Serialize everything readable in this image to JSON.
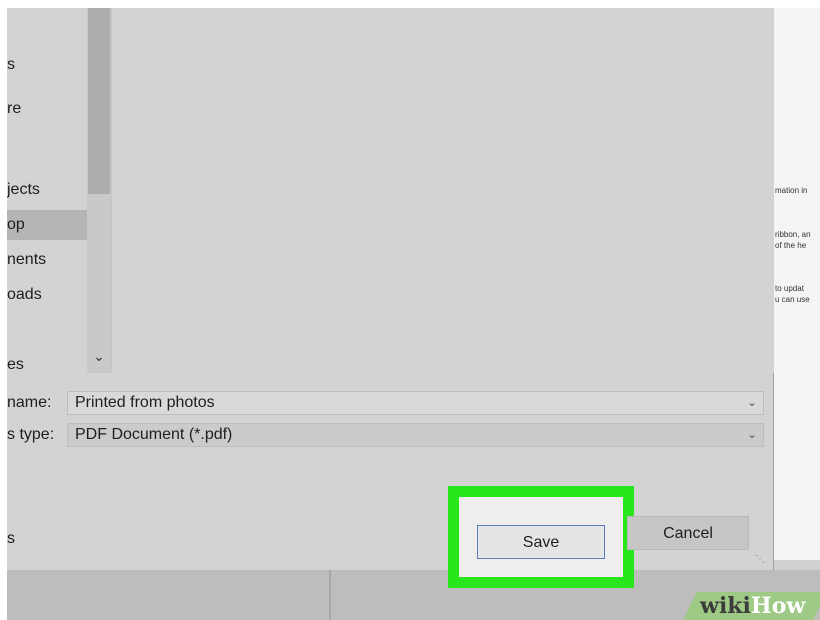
{
  "sidebar": {
    "items": [
      {
        "label": "s"
      },
      {
        "label": "re"
      },
      {
        "label": "jects"
      },
      {
        "label": "op"
      },
      {
        "label": "nents"
      },
      {
        "label": "oads"
      },
      {
        "label": "es"
      }
    ],
    "bottom_item": "s"
  },
  "file_name": {
    "label": "name:",
    "value": "Printed from photos"
  },
  "save_as_type": {
    "label": "s type:",
    "value": "PDF Document (*.pdf)"
  },
  "buttons": {
    "save": "Save",
    "cancel": "Cancel"
  },
  "background_doc": {
    "lines": [
      "mation in",
      "ribbon, an",
      "of the he",
      "to updat",
      "u can use"
    ]
  },
  "watermark": {
    "part1": "wiki",
    "part2": "How"
  },
  "colors": {
    "highlight": "#29e61c",
    "save_border": "#5b79b8"
  }
}
